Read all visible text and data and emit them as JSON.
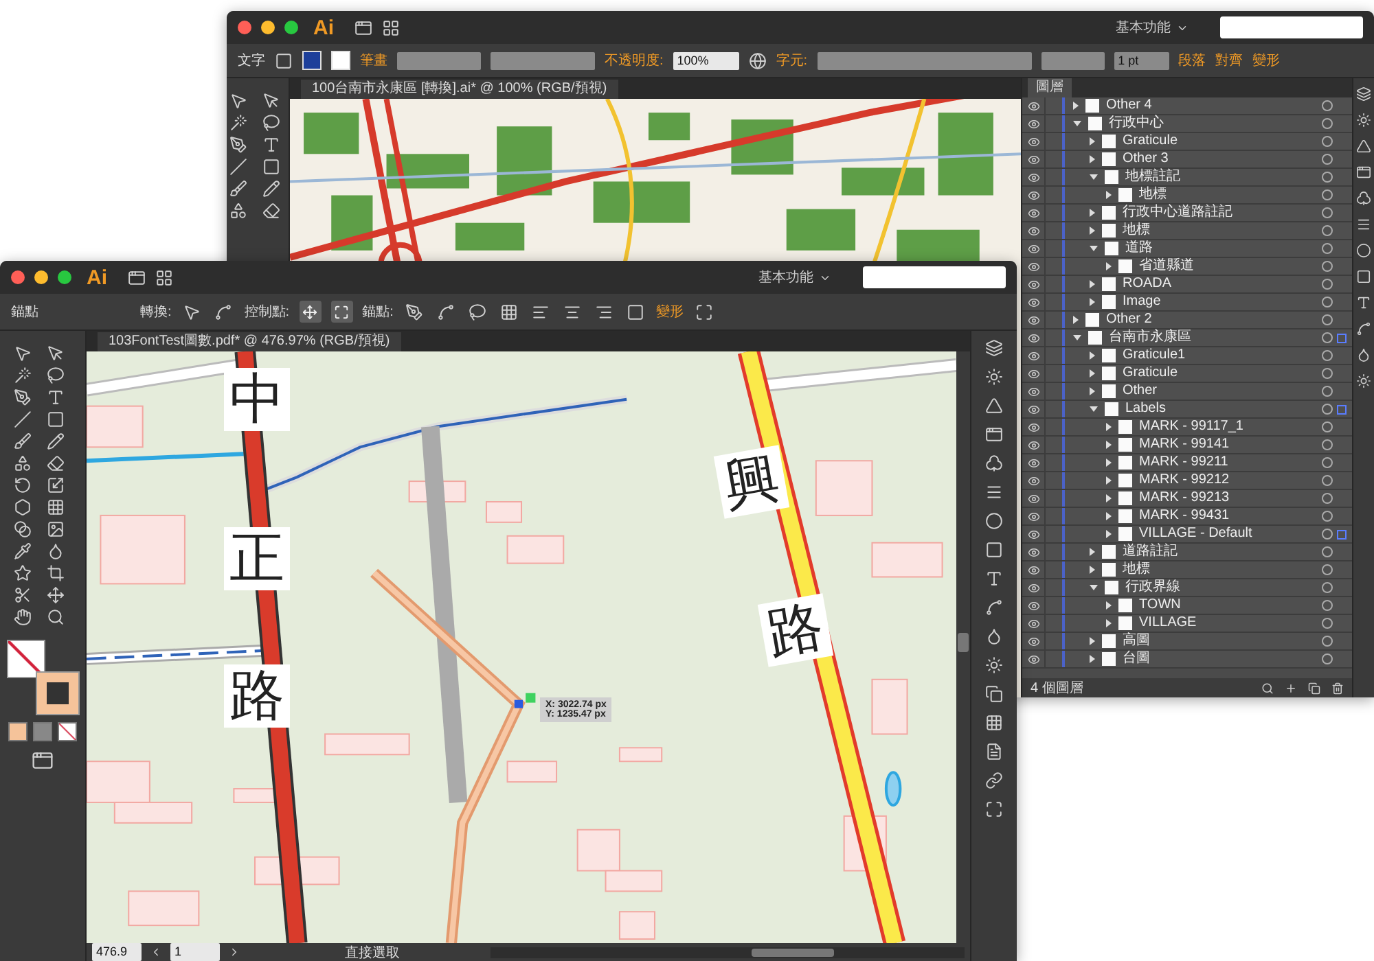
{
  "back_window": {
    "app_logo": "Ai",
    "workspace": "基本功能",
    "control_bar": {
      "selection": "文字",
      "stroke_link": "筆畫",
      "opacity_link": "不透明度:",
      "opacity": "100%",
      "character_link": "字元:",
      "stroke_weight": "1 pt",
      "links": [
        "段落",
        "對齊",
        "變形"
      ]
    },
    "document_tab": "100台南市永康區 [轉換].ai* @ 100% (RGB/預視)",
    "layers_panel": {
      "title": "圖層",
      "footer": "4 個圖層",
      "layers": [
        {
          "name": "Other 4",
          "expanded": false,
          "selected": false
        },
        {
          "name": "行政中心",
          "expanded": true,
          "selected": false,
          "children": [
            {
              "name": "Graticule",
              "expanded": false,
              "selected": false
            },
            {
              "name": "Other 3",
              "expanded": false,
              "selected": false
            },
            {
              "name": "地標註記",
              "expanded": true,
              "selected": false,
              "children": [
                {
                  "name": "地標",
                  "expanded": false,
                  "selected": false
                }
              ]
            },
            {
              "name": "行政中心道路註記",
              "expanded": false,
              "selected": false
            },
            {
              "name": "地標",
              "expanded": false,
              "selected": false
            },
            {
              "name": "道路",
              "expanded": true,
              "selected": false,
              "children": [
                {
                  "name": "省道縣道",
                  "expanded": false,
                  "selected": false
                }
              ]
            },
            {
              "name": "ROADA",
              "expanded": false,
              "selected": false
            },
            {
              "name": "Image",
              "expanded": false,
              "selected": false
            }
          ]
        },
        {
          "name": "Other 2",
          "expanded": false,
          "selected": false
        },
        {
          "name": "台南市永康區",
          "expanded": true,
          "selected": true,
          "children": [
            {
              "name": "Graticule1",
              "expanded": false,
              "selected": false
            },
            {
              "name": "Graticule",
              "expanded": false,
              "selected": false
            },
            {
              "name": "Other",
              "expanded": false,
              "selected": false
            },
            {
              "name": "Labels",
              "expanded": true,
              "selected": true,
              "children": [
                {
                  "name": "MARK - 99117_1",
                  "expanded": false,
                  "selected": false
                },
                {
                  "name": "MARK - 99141",
                  "expanded": false,
                  "selected": false
                },
                {
                  "name": "MARK - 99211",
                  "expanded": false,
                  "selected": false
                },
                {
                  "name": "MARK - 99212",
                  "expanded": false,
                  "selected": false
                },
                {
                  "name": "MARK - 99213",
                  "expanded": false,
                  "selected": false
                },
                {
                  "name": "MARK - 99431",
                  "expanded": false,
                  "selected": false
                },
                {
                  "name": "VILLAGE - Default",
                  "expanded": false,
                  "selected": true
                }
              ]
            },
            {
              "name": "道路註記",
              "expanded": false,
              "selected": false
            },
            {
              "name": "地標",
              "expanded": false,
              "selected": false
            },
            {
              "name": "行政界線",
              "expanded": true,
              "selected": false,
              "children": [
                {
                  "name": "TOWN",
                  "expanded": false,
                  "selected": false
                },
                {
                  "name": "VILLAGE",
                  "expanded": false,
                  "selected": false
                }
              ]
            },
            {
              "name": "高圖",
              "expanded": false,
              "selected": false
            },
            {
              "name": "台圖",
              "expanded": false,
              "selected": false
            }
          ]
        }
      ]
    }
  },
  "front_window": {
    "app_logo": "Ai",
    "workspace": "基本功能",
    "control_bar": {
      "selection": "錨點",
      "convert_label": "轉換:",
      "handles_label": "控制點:",
      "anchors_label": "錨點:",
      "transform_link": "變形"
    },
    "document_tab": "103FontTest圖數.pdf* @ 476.97% (RGB/預視)",
    "map_labels": [
      "中",
      "正",
      "路",
      "興",
      "路"
    ],
    "tooltip": [
      "X: 3022.74 px",
      "Y: 1235.47 px"
    ],
    "status_bar": {
      "zoom": "476.9",
      "artboard": "1",
      "tool": "直接選取"
    }
  }
}
